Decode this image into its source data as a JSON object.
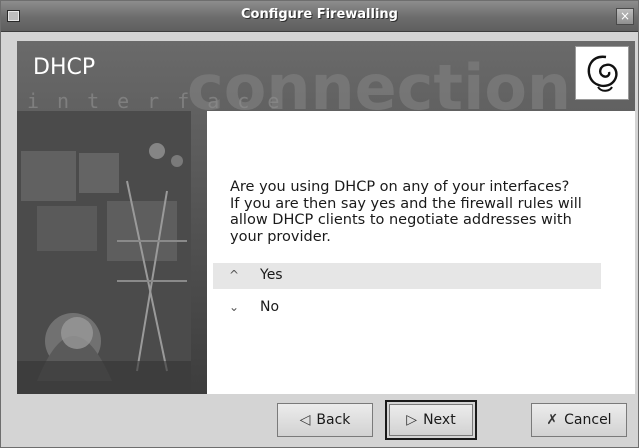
{
  "window": {
    "title": "Configure Firewalling",
    "close_glyph": "×"
  },
  "banner": {
    "heading": "DHCP",
    "logo": "debian-swirl-logo"
  },
  "question": {
    "text": "Are you using DHCP on any of your interfaces?\nIf you are then say yes and the firewall rules will\nallow DHCP clients to negotiate addresses with\nyour provider."
  },
  "options": [
    {
      "label": "Yes",
      "selected": true,
      "arrow": "^"
    },
    {
      "label": "No",
      "selected": false,
      "arrow": "⌄"
    }
  ],
  "buttons": {
    "back": "Back",
    "next": "Next",
    "cancel": "Cancel"
  }
}
